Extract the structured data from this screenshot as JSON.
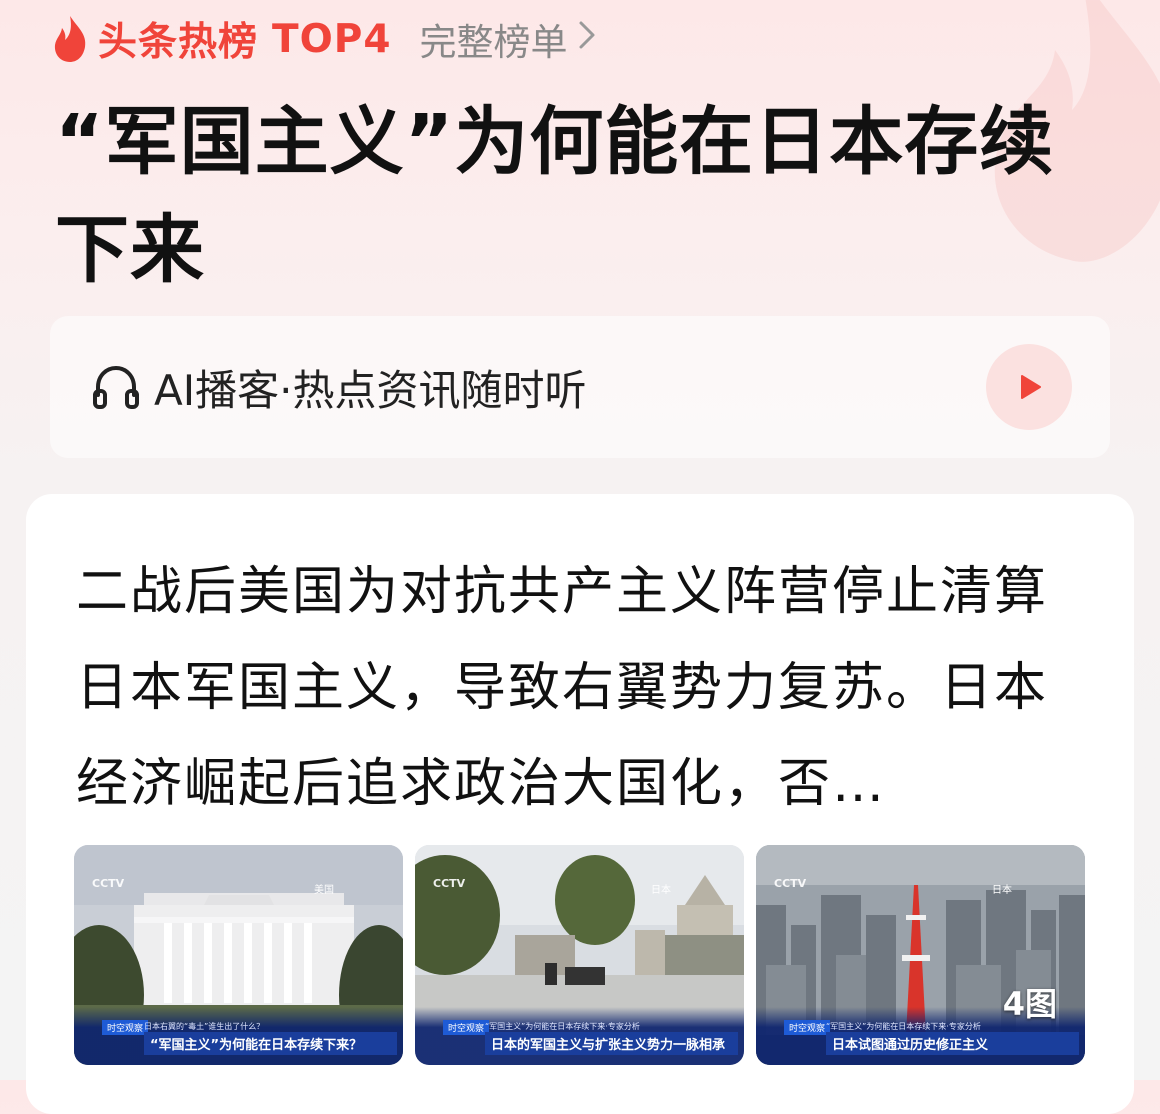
{
  "header": {
    "brand": "头条热榜",
    "rank": "TOP4",
    "full_list_label": "完整榜单"
  },
  "article": {
    "title": "“军国主义”为何能在日本存续下来"
  },
  "podcast": {
    "label": "AI播客·热点资讯随时听"
  },
  "summary": {
    "text": "二战后美国为对抗共产主义阵营停止清算日本军国主义，导致右翼势力复苏。日本经济崛起后追求政治大国化，否…"
  },
  "images": {
    "count_label": "4图",
    "items": [
      {
        "channel": "美国",
        "tag": "时空观察",
        "caption_top": "日本右翼的“毒土”谁生出了什么？",
        "caption": "“军国主义”为何能在日本存续下来？"
      },
      {
        "channel": "日本",
        "tag": "时空观察",
        "caption_top": "“军国主义”为何能在日本存续下来·专家分析",
        "caption": "日本的军国主义与扩张主义势力一脉相承"
      },
      {
        "channel": "日本",
        "tag": "时空观察",
        "caption_top": "“军国主义”为何能在日本存续下来·专家分析",
        "caption": "日本试图通过历史修正主义"
      }
    ]
  },
  "colors": {
    "brand_red": "#f0443a",
    "caption_blue": "#1a3e9c"
  },
  "icons": [
    "flame-icon",
    "chevron-right-icon",
    "headphone-icon",
    "play-icon"
  ]
}
